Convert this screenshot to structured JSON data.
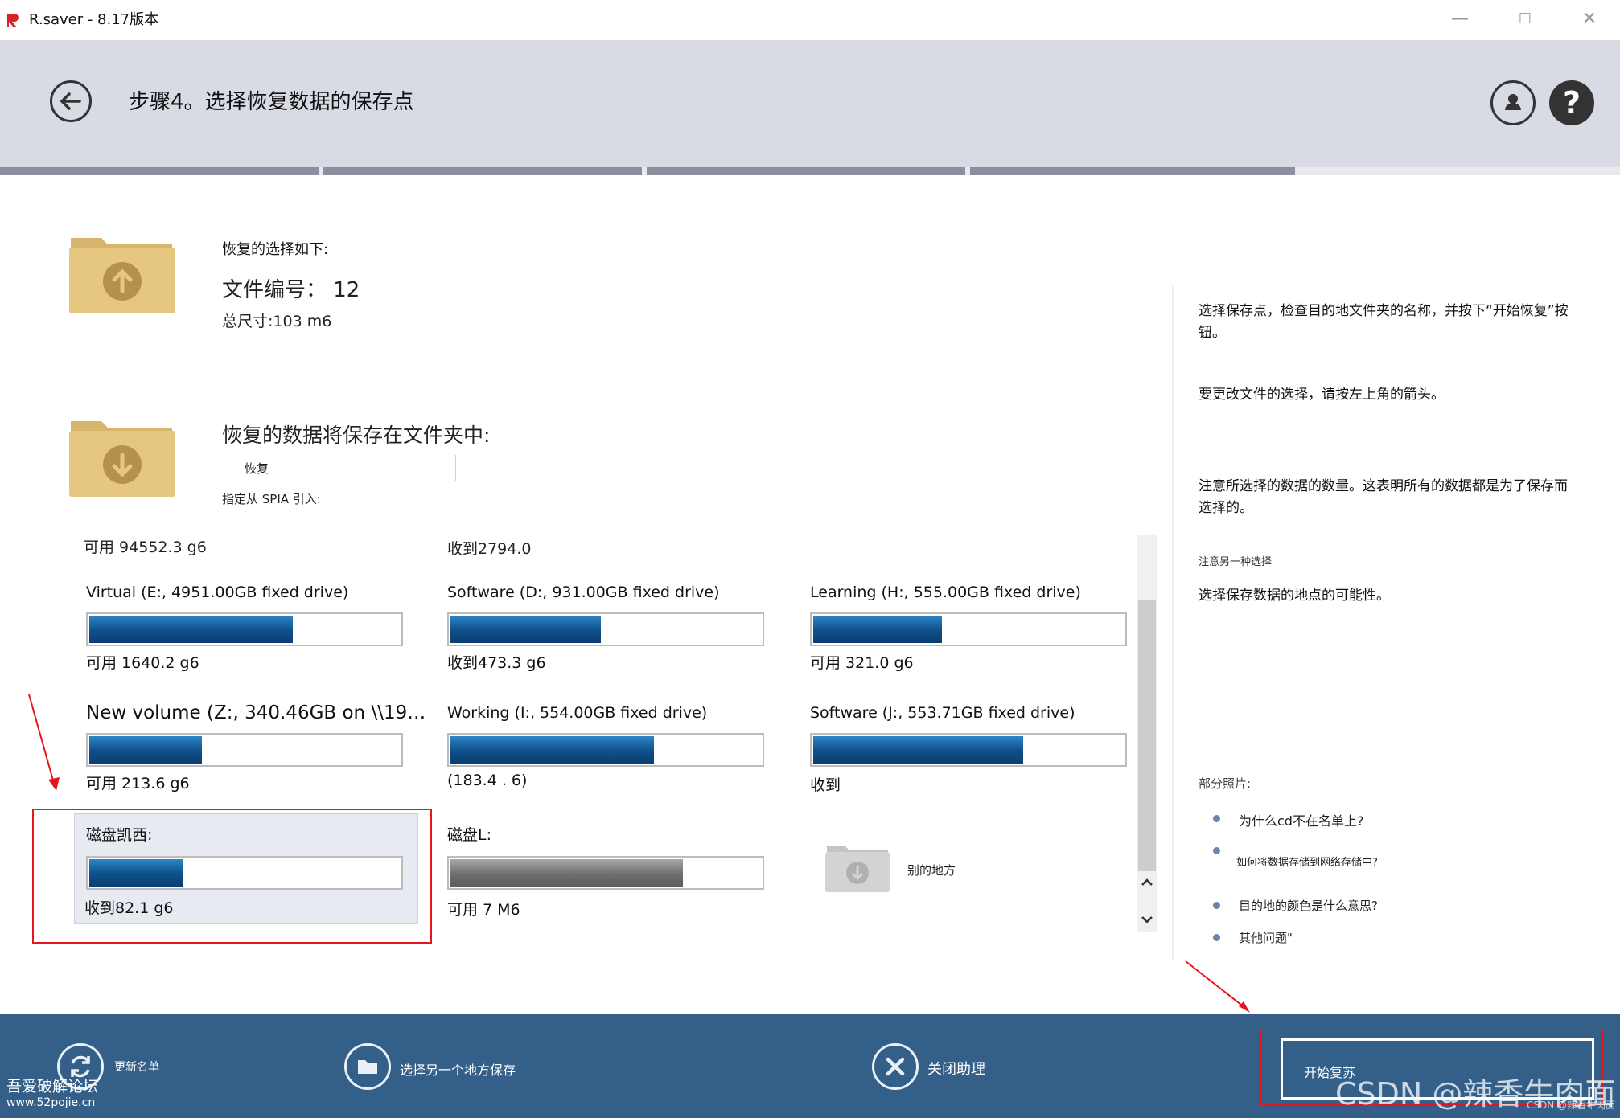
{
  "window": {
    "title": "R.saver - 8.17版本",
    "minimize": "—",
    "maximize": "☐",
    "close": "✕"
  },
  "header": {
    "step_title": "步骤4。选择恢复数据的保存点",
    "help_label": "?"
  },
  "source": {
    "heading": "恢复的选择如下:",
    "file_count": "文件编号： 12",
    "total_size": "总尺寸:103 m6"
  },
  "destination": {
    "heading": "恢复的数据将保存在文件夹中:",
    "folder_value": "恢复",
    "import_label": "指定从 SPIA 引入:"
  },
  "drive_list": {
    "top_left": "可用 94552.3 g6",
    "top_middle": "收到2794.0",
    "drives": [
      {
        "name": "Virtual (E:, 4951.00GB fixed drive)",
        "avail": "可用 1640.2 g6",
        "fill": 0.66,
        "kind": "blue"
      },
      {
        "name": "Software (D:, 931.00GB fixed drive)",
        "avail": "收到473.3 g6",
        "fill": 0.49,
        "kind": "blue"
      },
      {
        "name": "Learning (H:, 555.00GB fixed drive)",
        "avail": "可用 321.0 g6",
        "fill": 0.42,
        "kind": "blue"
      },
      {
        "name": "New volume (Z:, 340.46GB on \\\\192.168...",
        "avail": "可用 213.6 g6",
        "fill": 0.37,
        "kind": "blue"
      },
      {
        "name": "Working (I:, 554.00GB fixed drive)",
        "avail": "(183.4 . 6)",
        "fill": 0.66,
        "kind": "blue"
      },
      {
        "name": "Software (J:, 553.71GB fixed drive)",
        "avail": "收到",
        "fill": 0.68,
        "kind": "blue"
      },
      {
        "name": "磁盘凯西:",
        "avail": "收到82.1 g6",
        "fill": 0.31,
        "kind": "blue"
      },
      {
        "name": "磁盘L:",
        "avail": "可用 7 M6",
        "fill": 0.75,
        "kind": "gray"
      }
    ],
    "other_place": "别的地方"
  },
  "right_panel": {
    "p1": "选择保存点，检查目的地文件夹的名称，并按下“开始恢复”按钮。",
    "p2": "要更改文件的选择，请按左上角的箭头。",
    "p3": "注意所选择的数据的数量。这表明所有的数据都是为了保存而选择的。",
    "p4": "注意另一种选择",
    "p5": "选择保存数据的地点的可能性。",
    "faq_title": "部分照片:",
    "faq": [
      "为什么cd不在名单上?",
      "如何将数据存储到网络存储中?",
      "目的地的颜色是什么意思?",
      "其他问题\""
    ]
  },
  "footer": {
    "refresh": "更新名单",
    "save_elsewhere": "选择另一个地方保存",
    "close_assistant": "关闭助理",
    "start": "开始复苏"
  },
  "watermarks": {
    "left_title": "吾爱破解论坛",
    "left_url": "www.52pojie.cn",
    "right": "CSDN @辣香牛肉面",
    "right_small": "CSDN @辣香牛肉面"
  },
  "colors": {
    "header_bg": "#d9dbe4",
    "footer_bg": "#335f89",
    "bar_fill": "#0e4f89",
    "annotation": "#e4161c"
  }
}
